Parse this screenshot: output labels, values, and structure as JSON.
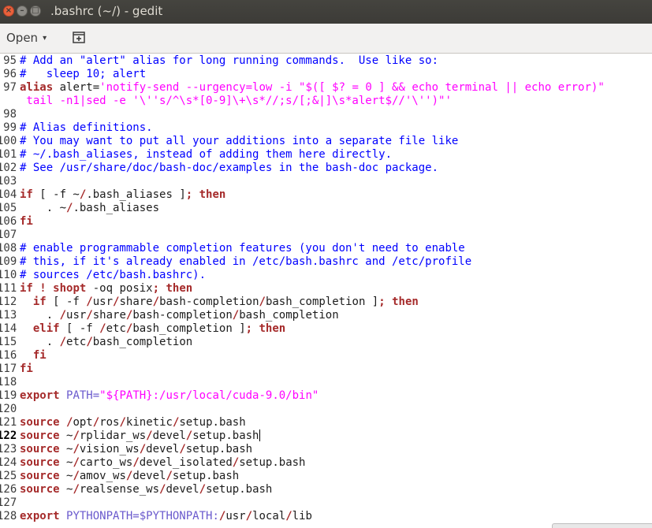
{
  "window": {
    "title": ".bashrc (~/) - gedit"
  },
  "window_controls": {
    "close": "×",
    "minimize": "–",
    "maximize": "□"
  },
  "toolbar": {
    "open_label": "Open",
    "open_arrow": "▾"
  },
  "editor": {
    "lines": [
      {
        "n": "95",
        "tokens": [
          [
            "cm",
            "# Add an \"alert\" alias for long running commands.  Use like so:"
          ]
        ]
      },
      {
        "n": "96",
        "tokens": [
          [
            "cm",
            "#   sleep 10; alert"
          ]
        ]
      },
      {
        "n": "97",
        "tokens": [
          [
            "kw",
            "alias"
          ],
          [
            "tx",
            " alert="
          ],
          [
            "st",
            "'notify-send --urgency=low -i \"$([ $? = 0 ] && echo terminal || echo error)\""
          ]
        ]
      },
      {
        "n": "",
        "tokens": [
          [
            "st",
            " tail -n1|sed -e '\\''s/^\\s*[0-9]\\+\\s*//;s/[;&|]\\s*alert$//'\\'')\"'"
          ]
        ]
      },
      {
        "n": "98",
        "tokens": []
      },
      {
        "n": "99",
        "tokens": [
          [
            "cm",
            "# Alias definitions."
          ]
        ]
      },
      {
        "n": "100",
        "tokens": [
          [
            "cm",
            "# You may want to put all your additions into a separate file like"
          ]
        ]
      },
      {
        "n": "101",
        "tokens": [
          [
            "cm",
            "# ~/.bash_aliases, instead of adding them here directly."
          ]
        ]
      },
      {
        "n": "102",
        "tokens": [
          [
            "cm",
            "# See /usr/share/doc/bash-doc/examples in the bash-doc package."
          ]
        ]
      },
      {
        "n": "103",
        "tokens": []
      },
      {
        "n": "104",
        "tokens": [
          [
            "kw",
            "if"
          ],
          [
            "tx",
            " [ -f ~"
          ],
          [
            "kw",
            "/"
          ],
          [
            "tx",
            ".bash_aliases ]"
          ],
          [
            "kw",
            ";"
          ],
          [
            "tx",
            " "
          ],
          [
            "kw",
            "then"
          ]
        ]
      },
      {
        "n": "105",
        "tokens": [
          [
            "tx",
            "    . ~"
          ],
          [
            "kw",
            "/"
          ],
          [
            "tx",
            ".bash_aliases"
          ]
        ]
      },
      {
        "n": "106",
        "tokens": [
          [
            "kw",
            "fi"
          ]
        ]
      },
      {
        "n": "107",
        "tokens": []
      },
      {
        "n": "108",
        "tokens": [
          [
            "cm",
            "# enable programmable completion features (you don't need to enable"
          ]
        ]
      },
      {
        "n": "109",
        "tokens": [
          [
            "cm",
            "# this, if it's already enabled in /etc/bash.bashrc and /etc/profile"
          ]
        ]
      },
      {
        "n": "110",
        "tokens": [
          [
            "cm",
            "# sources /etc/bash.bashrc)."
          ]
        ]
      },
      {
        "n": "111",
        "tokens": [
          [
            "kw",
            "if"
          ],
          [
            "tx",
            " "
          ],
          [
            "kw",
            "!"
          ],
          [
            "tx",
            " "
          ],
          [
            "kw",
            "shopt"
          ],
          [
            "tx",
            " -oq posix"
          ],
          [
            "kw",
            ";"
          ],
          [
            "tx",
            " "
          ],
          [
            "kw",
            "then"
          ]
        ]
      },
      {
        "n": "112",
        "tokens": [
          [
            "tx",
            "  "
          ],
          [
            "kw",
            "if"
          ],
          [
            "tx",
            " [ -f "
          ],
          [
            "kw",
            "/"
          ],
          [
            "tx",
            "usr"
          ],
          [
            "kw",
            "/"
          ],
          [
            "tx",
            "share"
          ],
          [
            "kw",
            "/"
          ],
          [
            "tx",
            "bash-completion"
          ],
          [
            "kw",
            "/"
          ],
          [
            "tx",
            "bash_completion ]"
          ],
          [
            "kw",
            ";"
          ],
          [
            "tx",
            " "
          ],
          [
            "kw",
            "then"
          ]
        ]
      },
      {
        "n": "113",
        "tokens": [
          [
            "tx",
            "    . "
          ],
          [
            "kw",
            "/"
          ],
          [
            "tx",
            "usr"
          ],
          [
            "kw",
            "/"
          ],
          [
            "tx",
            "share"
          ],
          [
            "kw",
            "/"
          ],
          [
            "tx",
            "bash-completion"
          ],
          [
            "kw",
            "/"
          ],
          [
            "tx",
            "bash_completion"
          ]
        ]
      },
      {
        "n": "114",
        "tokens": [
          [
            "tx",
            "  "
          ],
          [
            "kw",
            "elif"
          ],
          [
            "tx",
            " [ -f "
          ],
          [
            "kw",
            "/"
          ],
          [
            "tx",
            "etc"
          ],
          [
            "kw",
            "/"
          ],
          [
            "tx",
            "bash_completion ]"
          ],
          [
            "kw",
            ";"
          ],
          [
            "tx",
            " "
          ],
          [
            "kw",
            "then"
          ]
        ]
      },
      {
        "n": "115",
        "tokens": [
          [
            "tx",
            "    . "
          ],
          [
            "kw",
            "/"
          ],
          [
            "tx",
            "etc"
          ],
          [
            "kw",
            "/"
          ],
          [
            "tx",
            "bash_completion"
          ]
        ]
      },
      {
        "n": "116",
        "tokens": [
          [
            "tx",
            "  "
          ],
          [
            "kw",
            "fi"
          ]
        ]
      },
      {
        "n": "117",
        "tokens": [
          [
            "kw",
            "fi"
          ]
        ]
      },
      {
        "n": "118",
        "tokens": []
      },
      {
        "n": "119",
        "tokens": [
          [
            "kw",
            "export"
          ],
          [
            "tx",
            " "
          ],
          [
            "vr",
            "PATH="
          ],
          [
            "st",
            "\"${PATH}:/usr/local/cuda-9.0/bin\""
          ]
        ]
      },
      {
        "n": "120",
        "tokens": []
      },
      {
        "n": "121",
        "tokens": [
          [
            "kw",
            "source"
          ],
          [
            "tx",
            " "
          ],
          [
            "kw",
            "/"
          ],
          [
            "tx",
            "opt"
          ],
          [
            "kw",
            "/"
          ],
          [
            "tx",
            "ros"
          ],
          [
            "kw",
            "/"
          ],
          [
            "tx",
            "kinetic"
          ],
          [
            "kw",
            "/"
          ],
          [
            "tx",
            "setup.bash"
          ]
        ]
      },
      {
        "n": "122",
        "current": true,
        "caret": true,
        "tokens": [
          [
            "kw",
            "source"
          ],
          [
            "tx",
            " ~"
          ],
          [
            "kw",
            "/"
          ],
          [
            "tx",
            "rplidar_ws"
          ],
          [
            "kw",
            "/"
          ],
          [
            "tx",
            "devel"
          ],
          [
            "kw",
            "/"
          ],
          [
            "tx",
            "setup.bash"
          ]
        ]
      },
      {
        "n": "123",
        "tokens": [
          [
            "kw",
            "source"
          ],
          [
            "tx",
            " ~"
          ],
          [
            "kw",
            "/"
          ],
          [
            "tx",
            "vision_ws"
          ],
          [
            "kw",
            "/"
          ],
          [
            "tx",
            "devel"
          ],
          [
            "kw",
            "/"
          ],
          [
            "tx",
            "setup.bash"
          ]
        ]
      },
      {
        "n": "124",
        "tokens": [
          [
            "kw",
            "source"
          ],
          [
            "tx",
            " ~"
          ],
          [
            "kw",
            "/"
          ],
          [
            "tx",
            "carto_ws"
          ],
          [
            "kw",
            "/"
          ],
          [
            "tx",
            "devel_isolated"
          ],
          [
            "kw",
            "/"
          ],
          [
            "tx",
            "setup.bash"
          ]
        ]
      },
      {
        "n": "125",
        "tokens": [
          [
            "kw",
            "source"
          ],
          [
            "tx",
            " ~"
          ],
          [
            "kw",
            "/"
          ],
          [
            "tx",
            "amov_ws"
          ],
          [
            "kw",
            "/"
          ],
          [
            "tx",
            "devel"
          ],
          [
            "kw",
            "/"
          ],
          [
            "tx",
            "setup.bash"
          ]
        ]
      },
      {
        "n": "126",
        "tokens": [
          [
            "kw",
            "source"
          ],
          [
            "tx",
            " ~"
          ],
          [
            "kw",
            "/"
          ],
          [
            "tx",
            "realsense_ws"
          ],
          [
            "kw",
            "/"
          ],
          [
            "tx",
            "devel"
          ],
          [
            "kw",
            "/"
          ],
          [
            "tx",
            "setup.bash"
          ]
        ]
      },
      {
        "n": "127",
        "tokens": []
      },
      {
        "n": "128",
        "tokens": [
          [
            "kw",
            "export"
          ],
          [
            "tx",
            " "
          ],
          [
            "vr",
            "PYTHONPATH=$PYTHONPATH:"
          ],
          [
            "kw",
            "/"
          ],
          [
            "tx",
            "usr"
          ],
          [
            "kw",
            "/"
          ],
          [
            "tx",
            "local"
          ],
          [
            "kw",
            "/"
          ],
          [
            "tx",
            "lib"
          ]
        ]
      }
    ]
  },
  "colors": {
    "comment": "#0000ff",
    "keyword": "#a52a2a",
    "string": "#ff00ff",
    "variable": "#6a5acd",
    "titlebar": "#3c3b37",
    "close_button": "#e9613b"
  }
}
